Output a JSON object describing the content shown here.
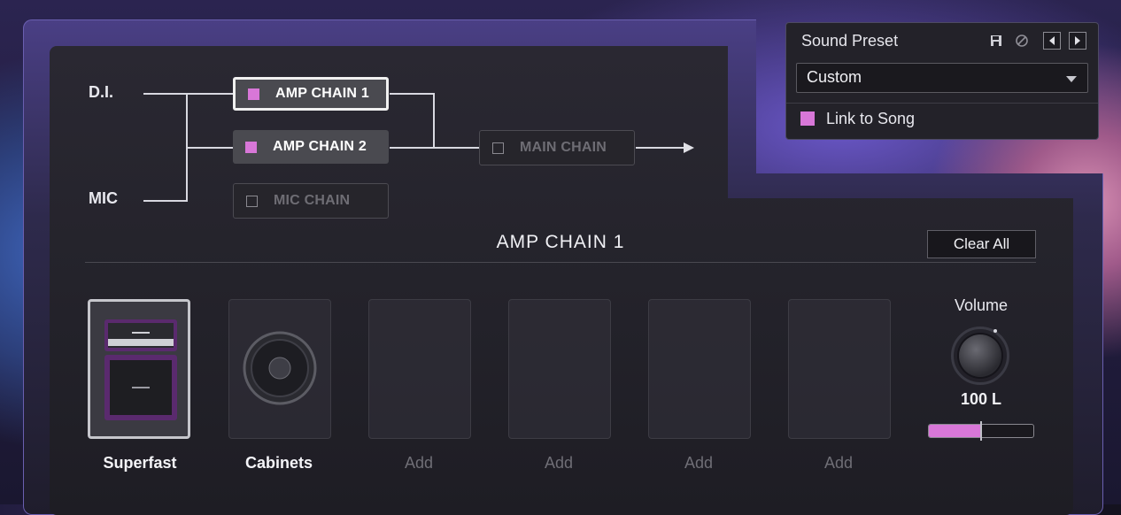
{
  "routing": {
    "inputs": [
      "D.I.",
      "MIC"
    ],
    "chains": [
      {
        "label": "AMP CHAIN 1",
        "enabled": true,
        "selected": true
      },
      {
        "label": "AMP CHAIN 2",
        "enabled": true,
        "selected": false
      },
      {
        "label": "MIC CHAIN",
        "enabled": false,
        "selected": false
      },
      {
        "label": "MAIN CHAIN",
        "enabled": false,
        "selected": false
      }
    ]
  },
  "preset": {
    "title": "Sound Preset",
    "selected": "Custom",
    "link_label": "Link to Song",
    "link_checked": true
  },
  "amp_chain": {
    "title": "AMP CHAIN 1",
    "clear_label": "Clear All",
    "slots": [
      {
        "label": "Superfast",
        "type": "amp-icon"
      },
      {
        "label": "Cabinets",
        "type": "speaker-icon"
      },
      {
        "label": "Add",
        "type": "empty"
      },
      {
        "label": "Add",
        "type": "empty"
      },
      {
        "label": "Add",
        "type": "empty"
      },
      {
        "label": "Add",
        "type": "empty"
      }
    ]
  },
  "volume": {
    "label": "Volume",
    "value_text": "100 L",
    "level": 0.5
  },
  "colors": {
    "accent": "#d877d8",
    "panel": "#24232b"
  }
}
